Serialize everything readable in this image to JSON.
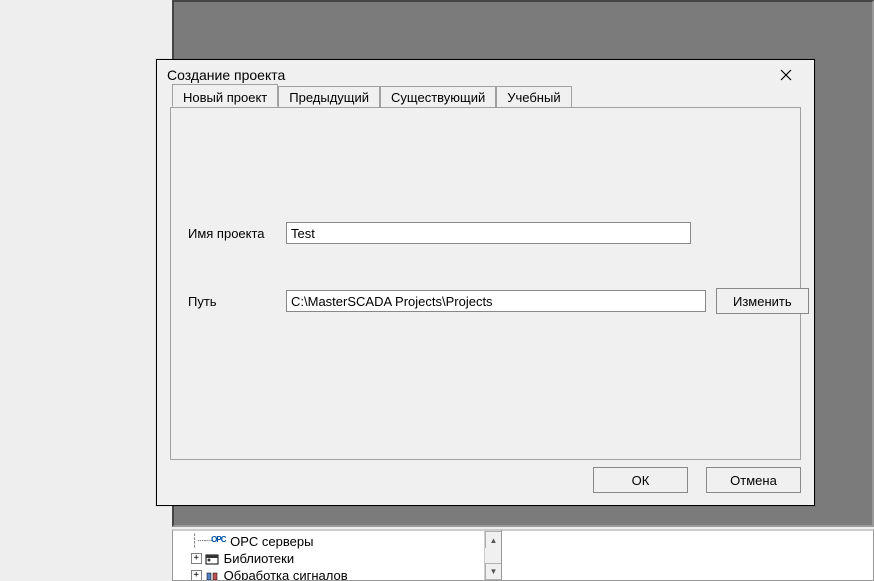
{
  "dialog": {
    "title": "Создание проекта",
    "tabs": [
      {
        "label": "Новый проект",
        "active": true
      },
      {
        "label": "Предыдущий",
        "active": false
      },
      {
        "label": "Существующий",
        "active": false
      },
      {
        "label": "Учебный",
        "active": false
      }
    ],
    "fields": {
      "name_label": "Имя проекта",
      "name_value": "Test",
      "path_label": "Путь",
      "path_value": "C:\\MasterSCADA Projects\\Projects",
      "change_button": "Изменить"
    },
    "buttons": {
      "ok": "ОК",
      "cancel": "Отмена"
    }
  },
  "tree": {
    "items": [
      {
        "expander": "",
        "icon": "opc-icon",
        "label": "OPC серверы"
      },
      {
        "expander": "+",
        "icon": "library-icon",
        "label": "Библиотеки"
      },
      {
        "expander": "+",
        "icon": "signals-icon",
        "label": "Обработка сигналов"
      }
    ]
  }
}
